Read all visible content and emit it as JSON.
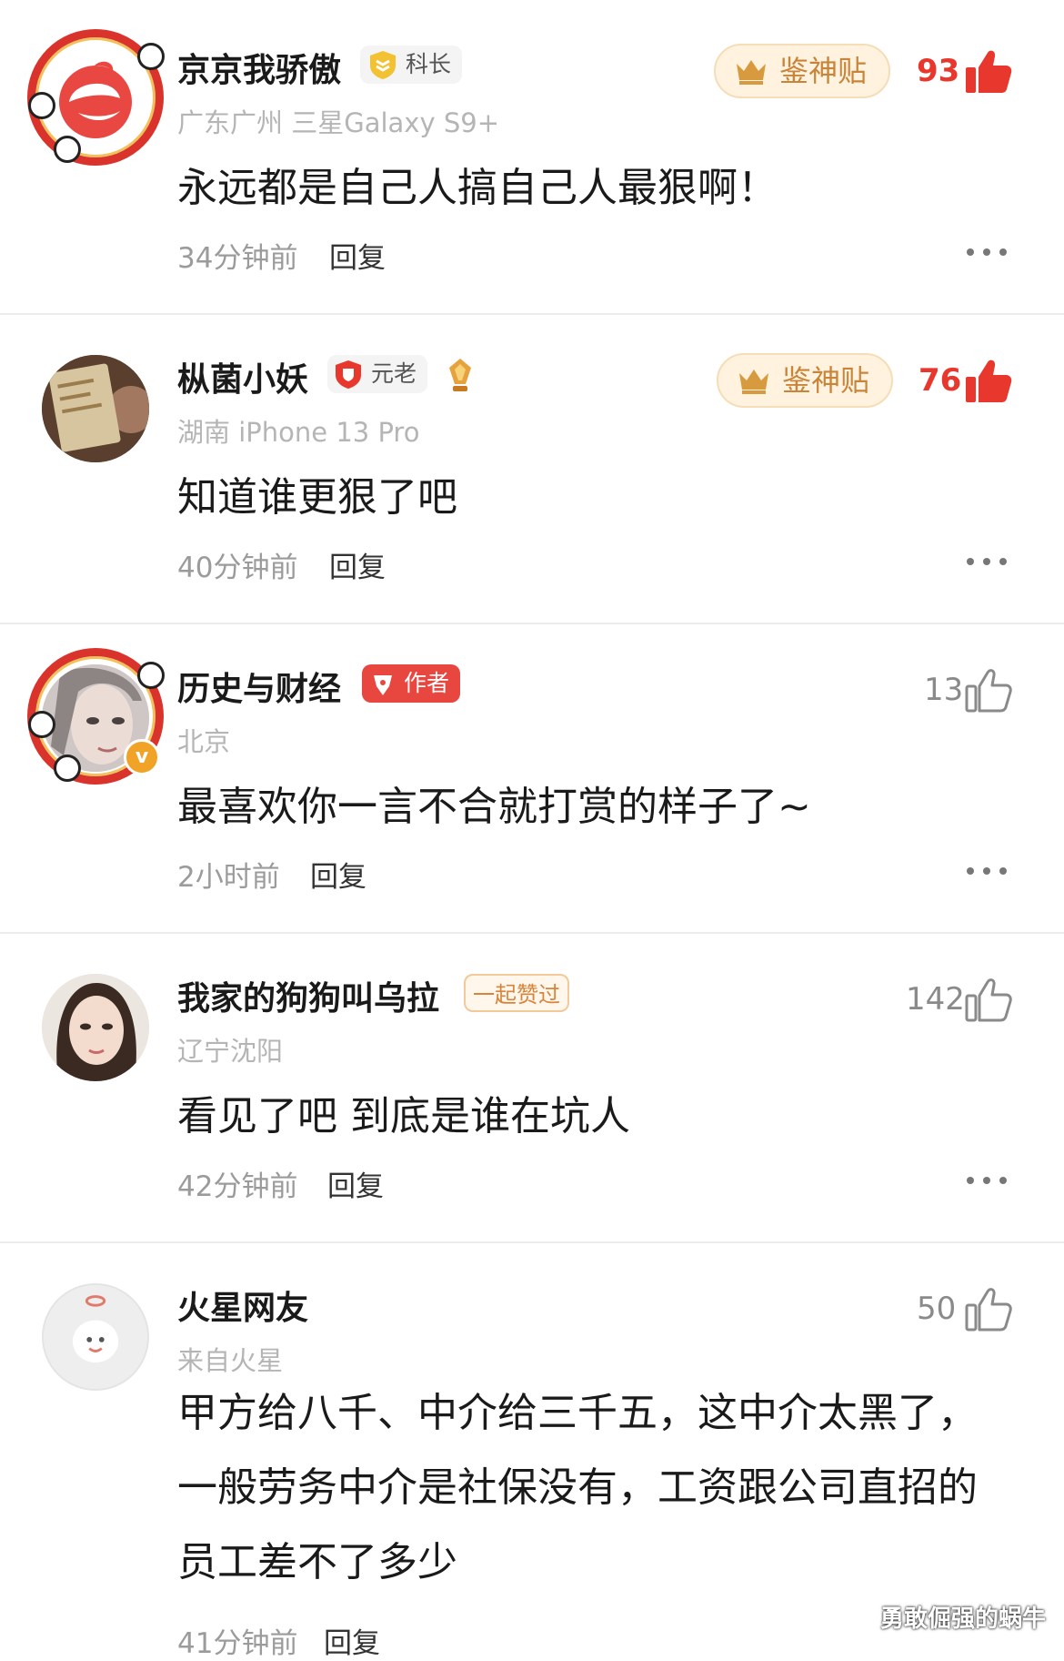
{
  "comments": [
    {
      "name": "京京我骄傲",
      "badge": "科长",
      "location": "广东广州  三星Galaxy S9+",
      "text": "永远都是自己人搞自己人最狠啊！",
      "time": "34分钟前",
      "reply": "回复",
      "god_label": "鉴神贴",
      "likes": "93"
    },
    {
      "name": "枞菌小妖",
      "badge": "元老",
      "location": "湖南  iPhone 13 Pro",
      "text": "知道谁更狠了吧",
      "time": "40分钟前",
      "reply": "回复",
      "god_label": "鉴神贴",
      "likes": "76"
    },
    {
      "name": "历史与财经",
      "badge": "作者",
      "location": "北京",
      "text": "最喜欢你一言不合就打赏的样子了~",
      "time": "2小时前",
      "reply": "回复",
      "likes": "13"
    },
    {
      "name": "我家的狗狗叫乌拉",
      "badge": "一起赞过",
      "location": "辽宁沈阳",
      "text": "看见了吧 到底是谁在坑人",
      "time": "42分钟前",
      "reply": "回复",
      "likes": "142"
    },
    {
      "name": "火星网友",
      "location": "来自火星",
      "text": "甲方给八千、中介给三千五，这中介太黑了，一般劳务中介是社保没有，工资跟公司直招的员工差不了多少",
      "time": "41分钟前",
      "reply": "回复",
      "likes": "50"
    }
  ],
  "watermark": "勇敢倔强的蜗牛",
  "colors": {
    "red": "#e8372d",
    "gold": "#c8853a",
    "gray": "#9b9b9b"
  },
  "icons": [
    "crown-icon",
    "thumb-up-filled-icon",
    "thumb-up-outline-icon",
    "more-icon",
    "shield-icon",
    "pen-icon",
    "trophy-icon"
  ]
}
